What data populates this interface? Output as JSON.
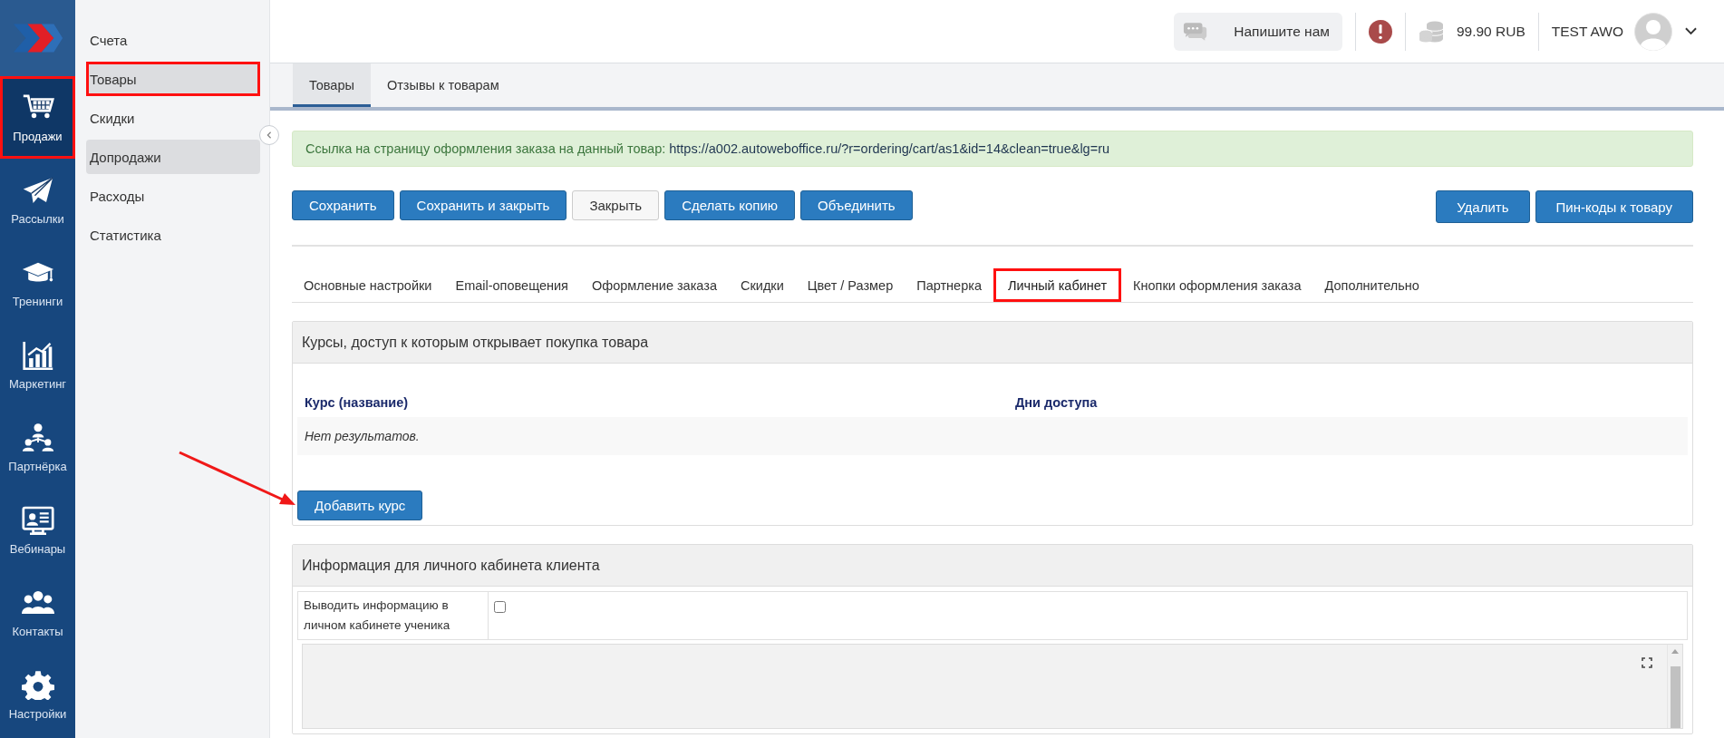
{
  "nav_rail": {
    "items": [
      {
        "label": "Продажи",
        "selected": true,
        "highlighted": true
      },
      {
        "label": "Рассылки",
        "selected": false,
        "highlighted": false
      },
      {
        "label": "Тренинги",
        "selected": false,
        "highlighted": false
      },
      {
        "label": "Маркетинг",
        "selected": false,
        "highlighted": false
      },
      {
        "label": "Партнёрка",
        "selected": false,
        "highlighted": false
      },
      {
        "label": "Вебинары",
        "selected": false,
        "highlighted": false
      },
      {
        "label": "Контакты",
        "selected": false,
        "highlighted": false
      },
      {
        "label": "Настройки",
        "selected": false,
        "highlighted": false
      }
    ]
  },
  "sub_menu": {
    "items": [
      {
        "label": "Счета",
        "selected": false,
        "highlighted": false
      },
      {
        "label": "Товары",
        "selected": true,
        "highlighted": true
      },
      {
        "label": "Скидки",
        "selected": false,
        "highlighted": false
      },
      {
        "label": "Допродажи",
        "selected": true,
        "highlighted": false
      },
      {
        "label": "Расходы",
        "selected": false,
        "highlighted": false
      },
      {
        "label": "Статистика",
        "selected": false,
        "highlighted": false
      }
    ]
  },
  "top_bar": {
    "chat_button": "Напишите нам",
    "balance": "99.90 RUB",
    "user": "TEST AWO"
  },
  "page_tabs": [
    {
      "label": "Товары",
      "selected": true
    },
    {
      "label": "Отзывы к товарам",
      "selected": false
    }
  ],
  "alert": {
    "text": "Ссылка на страницу оформления заказа на данный товар:",
    "link": "https://a002.autoweboffice.ru/?r=ordering/cart/as1&id=14&clean=true&lg=ru"
  },
  "actions_left": [
    {
      "label": "Сохранить",
      "kind": "primary"
    },
    {
      "label": "Сохранить и закрыть",
      "kind": "primary"
    },
    {
      "label": "Закрыть",
      "kind": "default"
    },
    {
      "label": "Сделать копию",
      "kind": "primary"
    },
    {
      "label": "Объединить",
      "kind": "primary"
    }
  ],
  "actions_right": [
    {
      "label": "Удалить",
      "kind": "primary"
    },
    {
      "label": "Пин-коды к товару",
      "kind": "primary"
    }
  ],
  "section_tabs": [
    {
      "label": "Основные настройки",
      "selected": false,
      "highlighted": false
    },
    {
      "label": "Email-оповещения",
      "selected": false,
      "highlighted": false
    },
    {
      "label": "Оформление заказа",
      "selected": false,
      "highlighted": false
    },
    {
      "label": "Скидки",
      "selected": false,
      "highlighted": false
    },
    {
      "label": "Цвет / Размер",
      "selected": false,
      "highlighted": false
    },
    {
      "label": "Партнерка",
      "selected": false,
      "highlighted": false
    },
    {
      "label": "Личный кабинет",
      "selected": true,
      "highlighted": true
    },
    {
      "label": "Кнопки оформления заказа",
      "selected": false,
      "highlighted": false
    },
    {
      "label": "Дополнительно",
      "selected": false,
      "highlighted": false
    }
  ],
  "courses_panel": {
    "title": "Курсы, доступ к которым открывает покупка товара",
    "table": {
      "columns": [
        "Курс (название)",
        "Дни доступа"
      ],
      "empty_text": "Нет результатов."
    },
    "add_button": "Добавить курс"
  },
  "client_panel": {
    "title": "Информация для личного кабинета клиента",
    "option": {
      "label": "Выводить информацию в личном кабинете ученика",
      "checked": false
    }
  }
}
